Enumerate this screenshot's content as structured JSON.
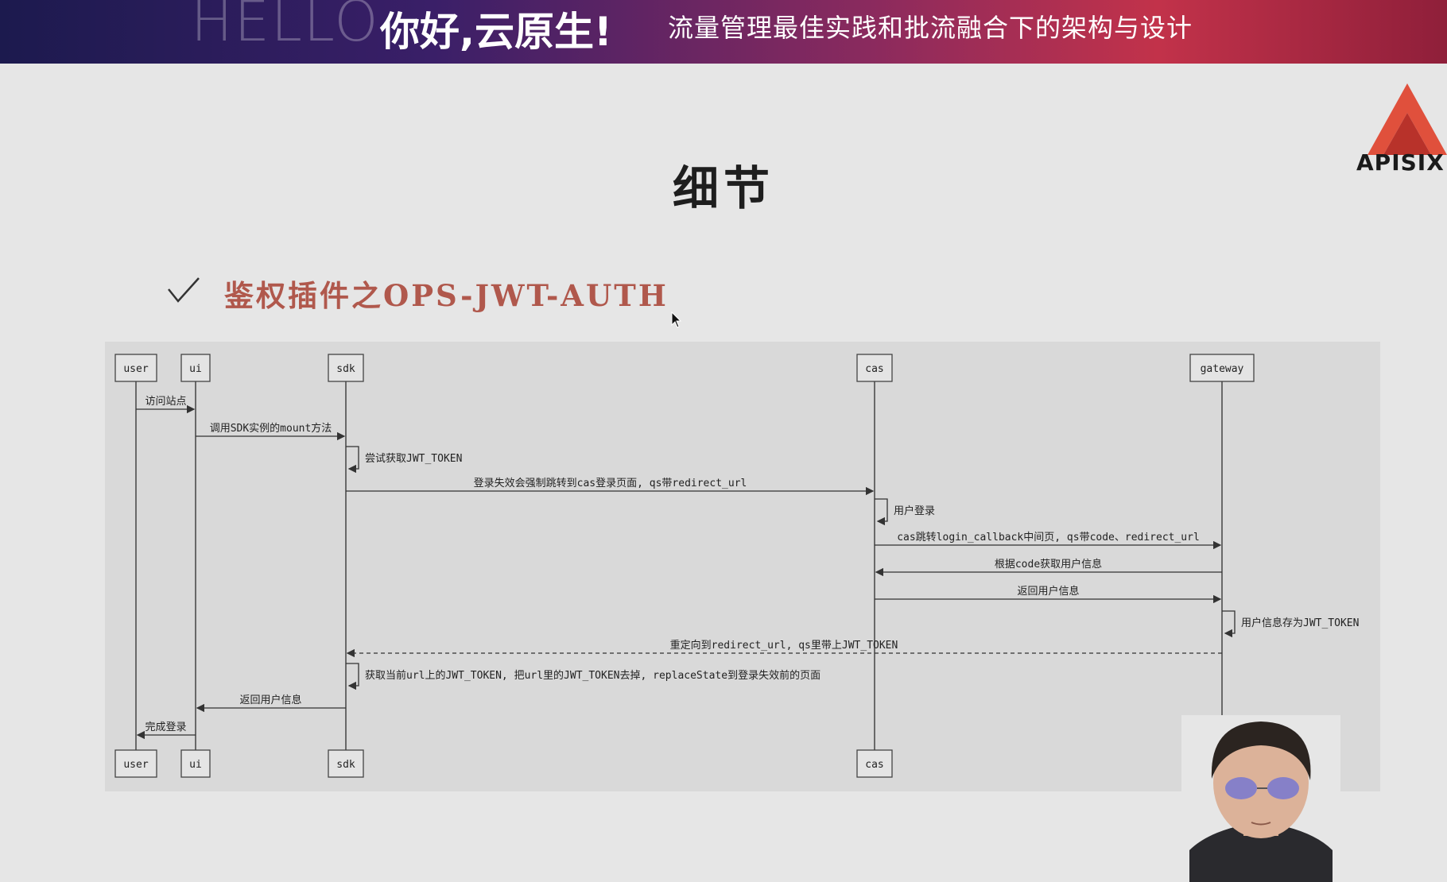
{
  "banner": {
    "hello": "HELLO",
    "main_title": "你好,云原生!",
    "subtitle": "流量管理最佳实践和批流融合下的架构与设计",
    "colors": {
      "start": "#1c1a4e",
      "end": "#c2324a"
    }
  },
  "slide": {
    "title": "细节",
    "section_title": "鉴权插件之OPS-JWT-AUTH",
    "logo_text": "APISIX",
    "accent_color": "#b0584c",
    "check_icon": "checkmark-icon"
  },
  "diagram": {
    "participants": [
      {
        "id": "user",
        "label": "user"
      },
      {
        "id": "ui",
        "label": "ui"
      },
      {
        "id": "sdk",
        "label": "sdk"
      },
      {
        "id": "cas",
        "label": "cas"
      },
      {
        "id": "gateway",
        "label": "gateway"
      }
    ],
    "messages": [
      {
        "from": "user",
        "to": "ui",
        "label": "访问站点",
        "style": "solid"
      },
      {
        "from": "ui",
        "to": "sdk",
        "label": "调用SDK实例的mount方法",
        "style": "solid"
      },
      {
        "from": "sdk",
        "to": "sdk",
        "label": "尝试获取JWT_TOKEN",
        "style": "self"
      },
      {
        "from": "sdk",
        "to": "cas",
        "label": "登录失效会强制跳转到cas登录页面, qs带redirect_url",
        "style": "solid"
      },
      {
        "from": "cas",
        "to": "cas",
        "label": "用户登录",
        "style": "self"
      },
      {
        "from": "cas",
        "to": "gateway",
        "label": "cas跳转login_callback中间页, qs带code、redirect_url",
        "style": "solid"
      },
      {
        "from": "gateway",
        "to": "cas",
        "label": "根据code获取用户信息",
        "style": "solid"
      },
      {
        "from": "cas",
        "to": "gateway",
        "label": "返回用户信息",
        "style": "solid"
      },
      {
        "from": "gateway",
        "to": "gateway",
        "label": "用户信息存为JWT_TOKEN",
        "style": "self"
      },
      {
        "from": "gateway",
        "to": "sdk",
        "label": "重定向到redirect_url, qs里带上JWT_TOKEN",
        "style": "dashed"
      },
      {
        "from": "sdk",
        "to": "sdk",
        "label": "获取当前url上的JWT_TOKEN, 把url里的JWT_TOKEN去掉, replaceState到登录失效前的页面",
        "style": "self"
      },
      {
        "from": "sdk",
        "to": "ui",
        "label": "返回用户信息",
        "style": "solid"
      },
      {
        "from": "ui",
        "to": "user",
        "label": "完成登录",
        "style": "solid"
      }
    ]
  }
}
